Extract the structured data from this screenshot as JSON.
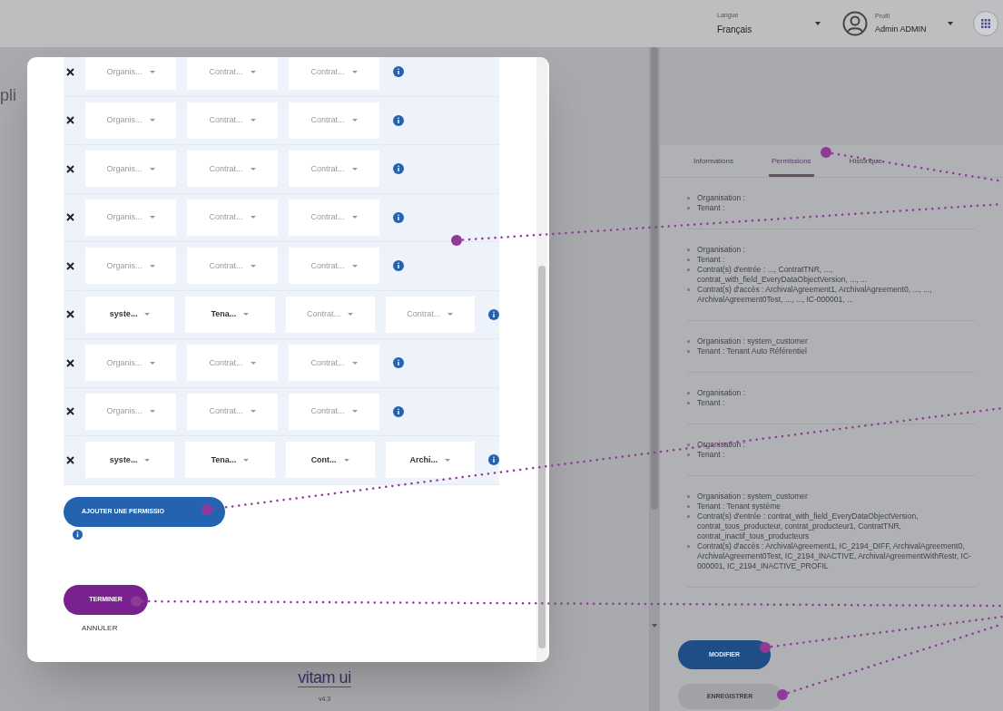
{
  "header": {
    "language": {
      "label": "Langue",
      "value": "Français"
    },
    "profile": {
      "label": "Profil",
      "value": "Admin ADMIN"
    }
  },
  "page": {
    "title_fragment": "pli",
    "logo": "vitam ui",
    "version": "v4.3"
  },
  "modal": {
    "rows": [
      {
        "selects": [
          {
            "text": "Organis...",
            "filled": false
          },
          {
            "text": "Contrat...",
            "filled": false
          },
          {
            "text": "Contrat...",
            "filled": false
          }
        ]
      },
      {
        "selects": [
          {
            "text": "Organis...",
            "filled": false
          },
          {
            "text": "Contrat...",
            "filled": false
          },
          {
            "text": "Contrat...",
            "filled": false
          }
        ]
      },
      {
        "selects": [
          {
            "text": "Organis...",
            "filled": false
          },
          {
            "text": "Contrat...",
            "filled": false
          },
          {
            "text": "Contrat...",
            "filled": false
          }
        ]
      },
      {
        "selects": [
          {
            "text": "Organis...",
            "filled": false
          },
          {
            "text": "Contrat...",
            "filled": false
          },
          {
            "text": "Contrat...",
            "filled": false
          }
        ]
      },
      {
        "selects": [
          {
            "text": "Organis...",
            "filled": false
          },
          {
            "text": "Contrat...",
            "filled": false
          },
          {
            "text": "Contrat...",
            "filled": false
          }
        ]
      },
      {
        "selects": [
          {
            "text": "syste...",
            "filled": true
          },
          {
            "text": "Tena...",
            "filled": true
          },
          {
            "text": "Contrat...",
            "filled": false
          },
          {
            "text": "Contrat...",
            "filled": false
          }
        ]
      },
      {
        "selects": [
          {
            "text": "Organis...",
            "filled": false
          },
          {
            "text": "Contrat...",
            "filled": false
          },
          {
            "text": "Contrat...",
            "filled": false
          }
        ]
      },
      {
        "selects": [
          {
            "text": "Organis...",
            "filled": false
          },
          {
            "text": "Contrat...",
            "filled": false
          },
          {
            "text": "Contrat...",
            "filled": false
          }
        ]
      },
      {
        "selects": [
          {
            "text": "syste...",
            "filled": true
          },
          {
            "text": "Tena...",
            "filled": true
          },
          {
            "text": "Cont...",
            "filled": true
          },
          {
            "text": "Archi...",
            "filled": true
          }
        ]
      }
    ],
    "add_button": "AJOUTER UNE PERMISSIO",
    "finish_button": "TERMINER",
    "cancel_link": "ANNULER"
  },
  "panel": {
    "tabs": [
      {
        "label": "Informations",
        "selected": false
      },
      {
        "label": "Permissions",
        "selected": true
      },
      {
        "label": "Historique",
        "selected": false
      }
    ],
    "sections": [
      [
        "Organisation :",
        "Tenant :"
      ],
      [
        "Organisation :",
        "Tenant :",
        "Contrat(s) d'entrée : ..., ContratTNR, ..., contrat_with_field_EveryDataObjectVersion, ..., ...",
        "Contrat(s) d'accès : ArchivalAgreement1, ArchivalAgreement0, ..., ..., ArchivalAgreement0Test, ..., ..., IC-000001, ..."
      ],
      [
        "Organisation : system_customer",
        "Tenant : Tenant Auto Référentiel"
      ],
      [
        "Organisation :",
        "Tenant :"
      ],
      [
        "Organisation :",
        "Tenant :"
      ],
      [
        "Organisation : system_customer",
        "Tenant : Tenant système",
        "Contrat(s) d'entrée : contrat_with_field_EveryDataObjectVersion, contrat_tous_producteur, contrat_producteur1, ContratTNR, contrat_inactif_tous_producteurs",
        "Contrat(s) d'accès : ArchivalAgreement1, IC_2194_DIFF, ArchivalAgreement0, ArchivalAgreement0Test, IC_2194_INACTIVE, ArchivalAgreementWithRestr, IC-000001, IC_2194_INACTIVE_PROFIL"
      ]
    ],
    "edit_button": "MODIFIER",
    "save_button": "ENREGISTRER"
  }
}
